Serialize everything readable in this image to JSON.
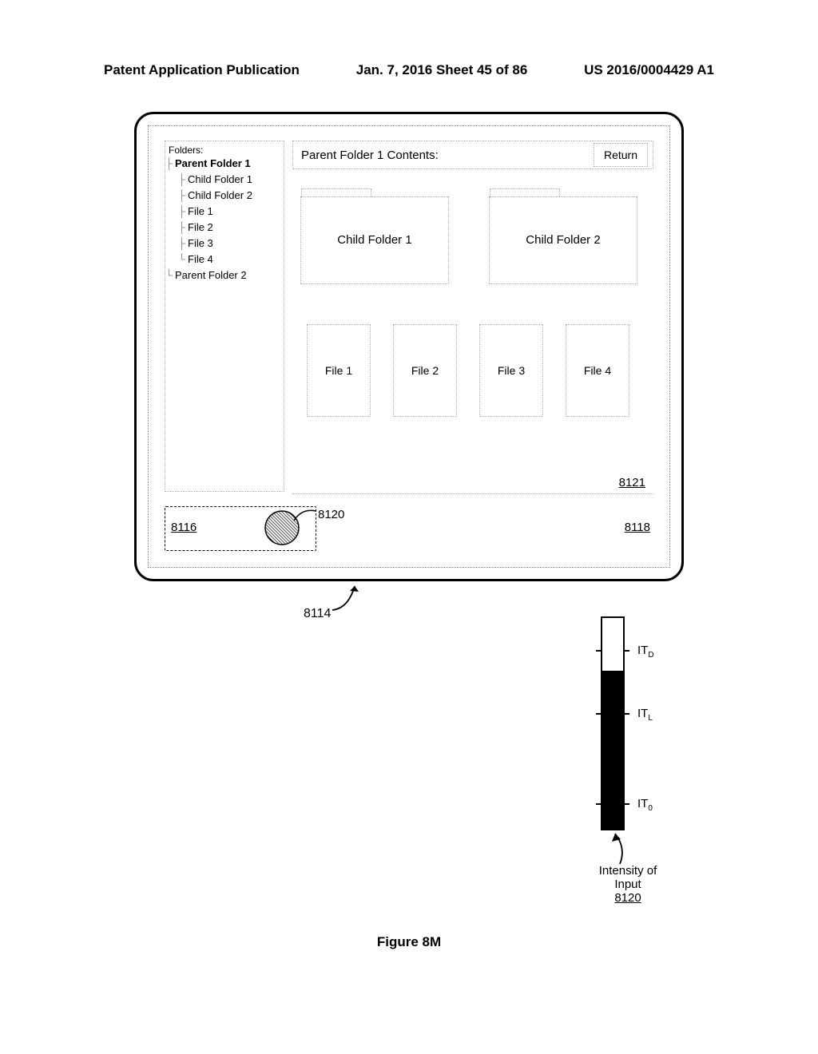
{
  "header": {
    "left": "Patent Application Publication",
    "center": "Jan. 7, 2016   Sheet 45 of 86",
    "right": "US 2016/0004429 A1"
  },
  "tree": {
    "title": "Folders:",
    "parent1": "Parent Folder 1",
    "child1": "Child Folder 1",
    "child2": "Child Folder 2",
    "file1": "File 1",
    "file2": "File 2",
    "file3": "File 3",
    "file4": "File 4",
    "parent2": "Parent Folder 2"
  },
  "content": {
    "header": "Parent Folder 1 Contents:",
    "return": "Return",
    "folder1": "Child Folder 1",
    "folder2": "Child Folder 2",
    "file1": "File 1",
    "file2": "File 2",
    "file3": "File 3",
    "file4": "File 4"
  },
  "refs": {
    "r8121": "8121",
    "r8116": "8116",
    "r8120": "8120",
    "r8118": "8118",
    "r8114": "8114"
  },
  "gauge": {
    "fill_percent": 75,
    "ticks": [
      {
        "pos_percent": 15,
        "label_html": "IT",
        "sub": "D"
      },
      {
        "pos_percent": 45,
        "label_html": "IT",
        "sub": "L"
      },
      {
        "pos_percent": 88,
        "label_html": "IT",
        "sub": "0"
      }
    ],
    "caption_line1": "Intensity of",
    "caption_line2": "Input",
    "caption_ref": "8120"
  },
  "figure": "Figure 8M"
}
